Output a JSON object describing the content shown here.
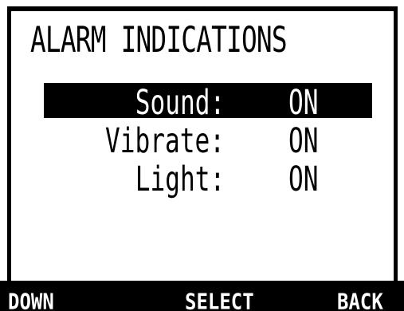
{
  "screen": {
    "title": "ALARM INDICATIONS"
  },
  "menu": {
    "items": [
      {
        "label": "Sound:",
        "value": "ON",
        "selected": true
      },
      {
        "label": "Vibrate:",
        "value": "ON",
        "selected": false
      },
      {
        "label": "Light:",
        "value": "ON",
        "selected": false
      }
    ]
  },
  "softkeys": {
    "left": "DOWN",
    "center": "SELECT",
    "right": "BACK"
  },
  "colors": {
    "background": "#ffffff",
    "foreground": "#000000",
    "highlight": "#000000",
    "highlight_text": "#ffffff"
  }
}
